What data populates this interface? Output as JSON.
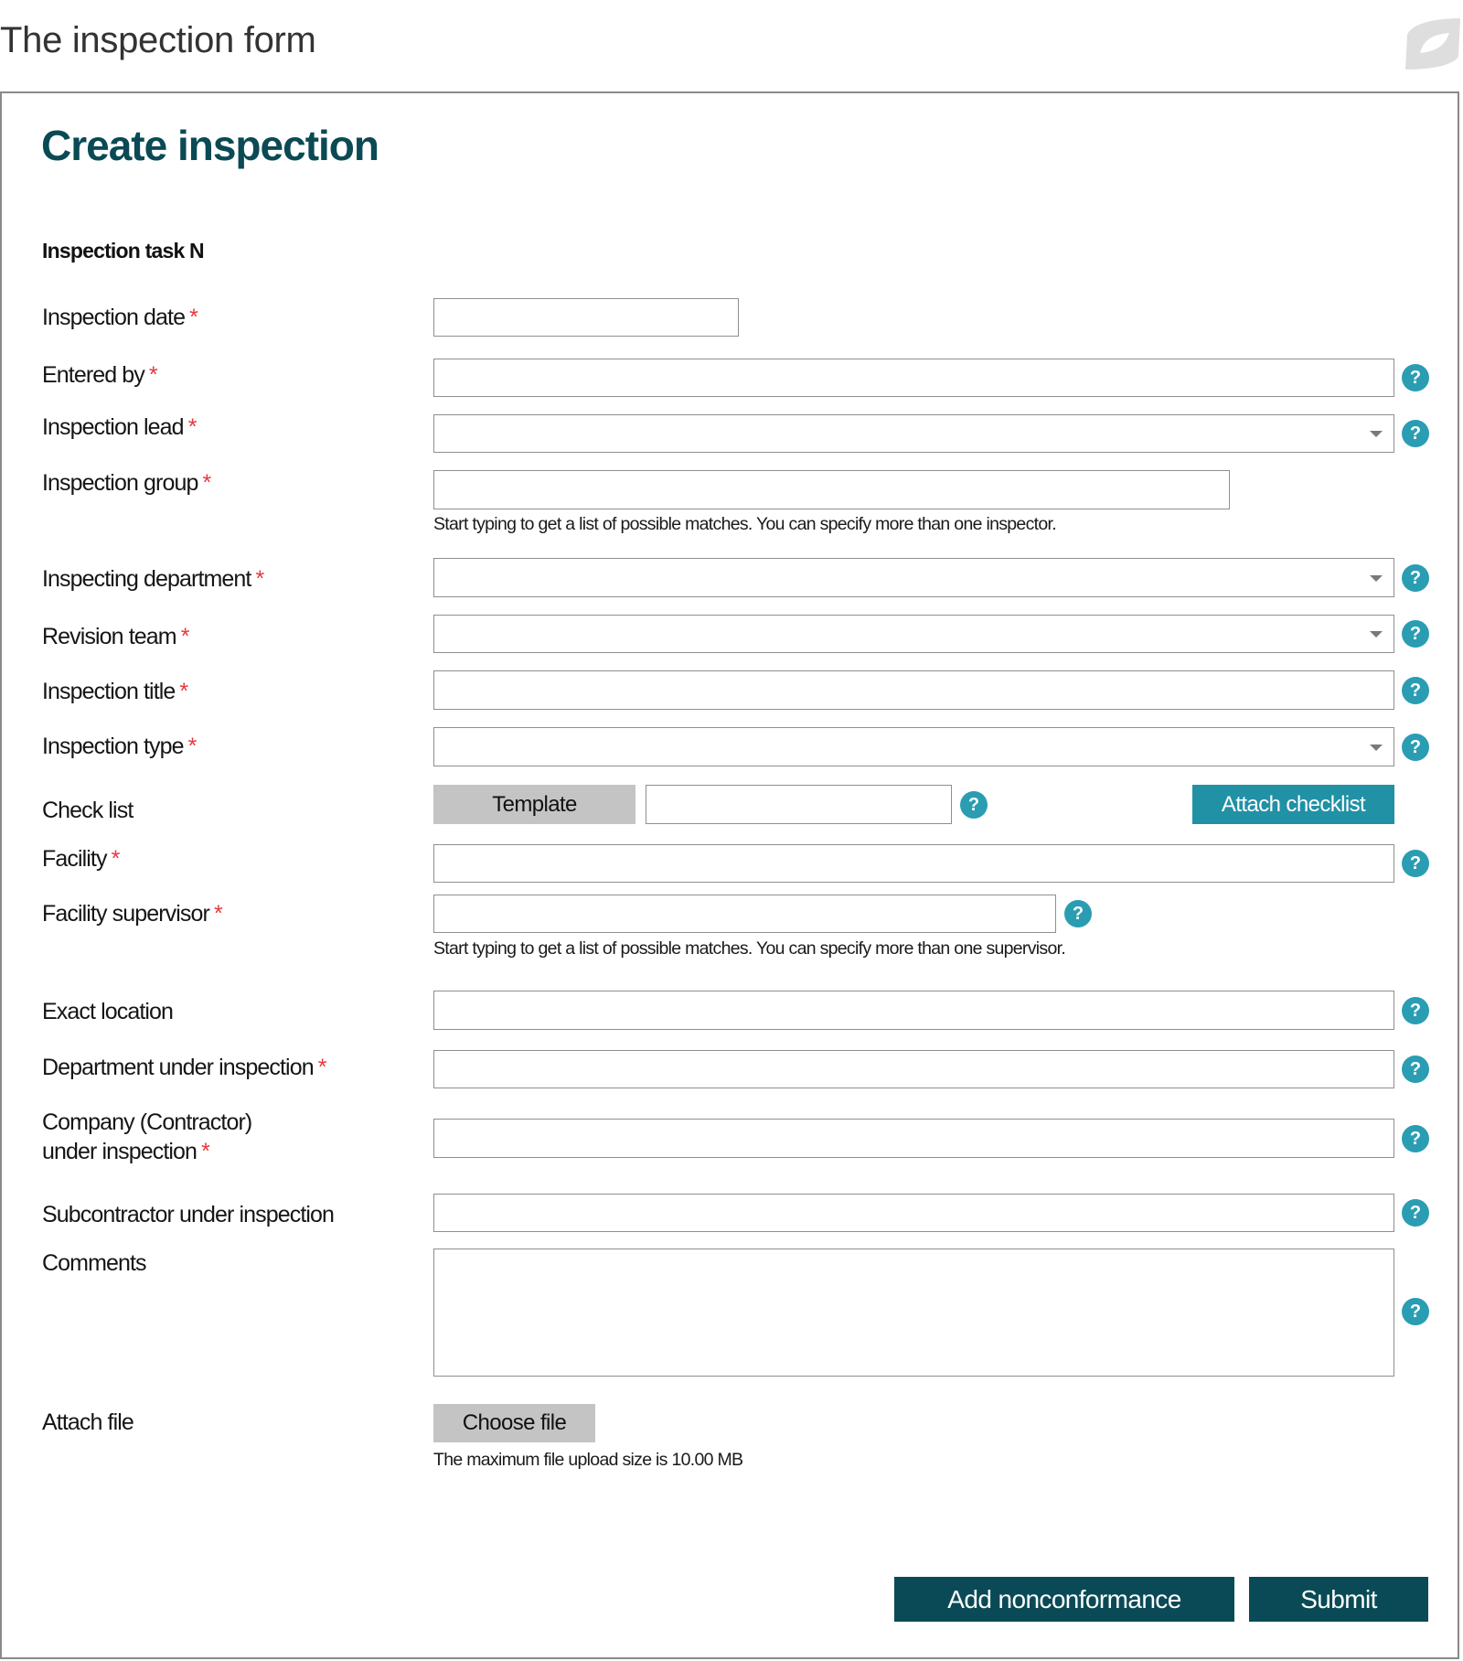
{
  "page": {
    "title": "The inspection form"
  },
  "form": {
    "title": "Create inspection",
    "section_title": "Inspection task N",
    "required_marker": "*",
    "fields": {
      "inspection_date": {
        "label": "Inspection date",
        "value": "",
        "required": true
      },
      "entered_by": {
        "label": "Entered by",
        "value": "",
        "required": true
      },
      "inspection_lead": {
        "label": "Inspection lead",
        "value": "",
        "required": true,
        "type": "select"
      },
      "inspection_group": {
        "label": "Inspection group",
        "value": "",
        "required": true,
        "hint": "Start typing to get a list of possible matches. You can specify more than one inspector."
      },
      "inspecting_department": {
        "label": "Inspecting department",
        "value": "",
        "required": true,
        "type": "select"
      },
      "revision_team": {
        "label": "Revision team",
        "value": "",
        "required": true,
        "type": "select"
      },
      "inspection_title": {
        "label": "Inspection title",
        "value": "",
        "required": true
      },
      "inspection_type": {
        "label": "Inspection type",
        "value": "",
        "required": true,
        "type": "select"
      },
      "check_list": {
        "label": "Check list",
        "value": "",
        "required": false,
        "template_button": "Template",
        "attach_button": "Attach checklist"
      },
      "facility": {
        "label": "Facility",
        "value": "",
        "required": true
      },
      "facility_supervisor": {
        "label": "Facility supervisor",
        "value": "",
        "required": true,
        "hint": "Start typing to get a list of possible matches. You can specify more than one supervisor."
      },
      "exact_location": {
        "label": "Exact location",
        "value": "",
        "required": false
      },
      "department_under_inspection": {
        "label": "Department under inspection",
        "value": "",
        "required": true
      },
      "company_under_inspection": {
        "label_line1": "Company (Contractor)",
        "label_line2": "under inspection",
        "value": "",
        "required": true
      },
      "subcontractor_under_inspection": {
        "label": "Subcontractor under inspection",
        "value": "",
        "required": false
      },
      "comments": {
        "label": "Comments",
        "value": "",
        "required": false
      },
      "attach_file": {
        "label": "Attach file",
        "button": "Choose file",
        "hint": "The maximum file upload size is 10.00 MB"
      }
    },
    "help_icon_glyph": "?",
    "actions": {
      "add_nonconformance": "Add nonconformance",
      "submit": "Submit"
    }
  },
  "colors": {
    "title": "#0b4a55",
    "required": "#e8373d",
    "help": "#2a9db3",
    "attach_button": "#2191a5",
    "primary_button": "#0a4a56",
    "secondary_button": "#c4c4c4"
  }
}
